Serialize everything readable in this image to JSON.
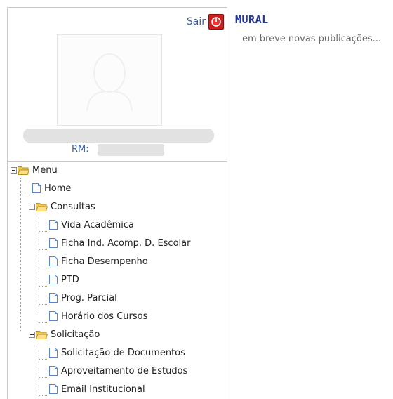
{
  "header": {
    "logout_label": "Sair"
  },
  "profile": {
    "rm_label": "RM:"
  },
  "menu": {
    "root": "Menu",
    "home": "Home",
    "consultas": {
      "label": "Consultas",
      "items": [
        "Vida Acadêmica",
        "Ficha Ind. Acomp. D. Escolar",
        "Ficha Desempenho",
        "PTD",
        "Prog. Parcial",
        "Horário dos Cursos"
      ]
    },
    "solicitacao": {
      "label": "Solicitação",
      "items": [
        "Solicitação de Documentos",
        "Aproveitamento de Estudos",
        "Email Institucional"
      ]
    }
  },
  "mural": {
    "title": "MURAL",
    "text": "em breve novas publicações..."
  },
  "colors": {
    "accent": "#24379a",
    "logout": "#cc1f1f",
    "folder": "#f2c94c"
  }
}
